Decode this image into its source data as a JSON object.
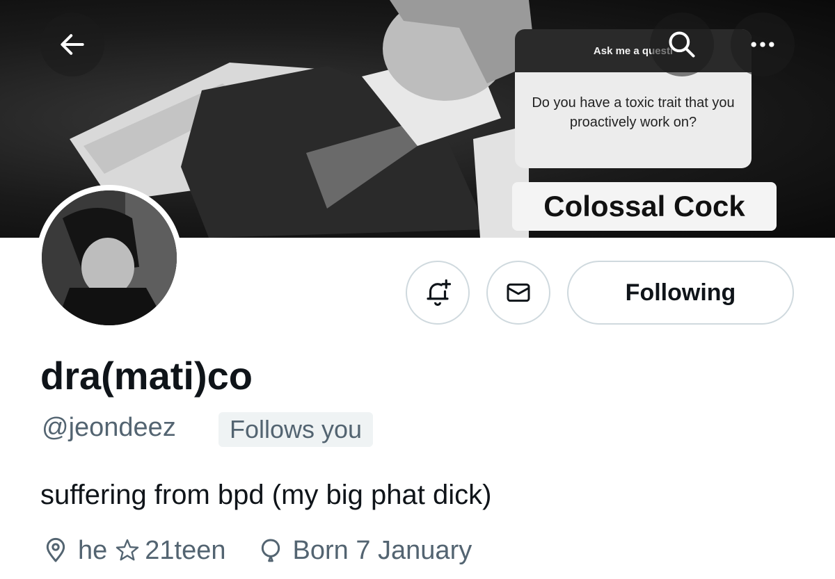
{
  "banner": {
    "story_card": {
      "ask_title": "Ask me a questi",
      "question": "Do you have a toxic trait that you proactively work on?"
    },
    "answer": "Colossal Cock"
  },
  "nav": {
    "back_icon": "arrow-left-icon",
    "search_icon": "search-icon",
    "more_icon": "more-dots-icon"
  },
  "profile": {
    "display_name": "dra(mati)co",
    "handle": "@jeondeez",
    "follows_you": "Follows you",
    "bio": "suffering from bpd (my big phat dick)",
    "location": "he",
    "location_extra": "21teen",
    "birthday": "Born 7 January"
  },
  "actions": {
    "notify_icon": "bell-plus-icon",
    "message_icon": "envelope-icon",
    "following_label": "Following"
  },
  "colors": {
    "text_primary": "#0f1419",
    "text_secondary": "#536471",
    "border": "#cfd9de",
    "badge_bg": "#eff3f4"
  }
}
